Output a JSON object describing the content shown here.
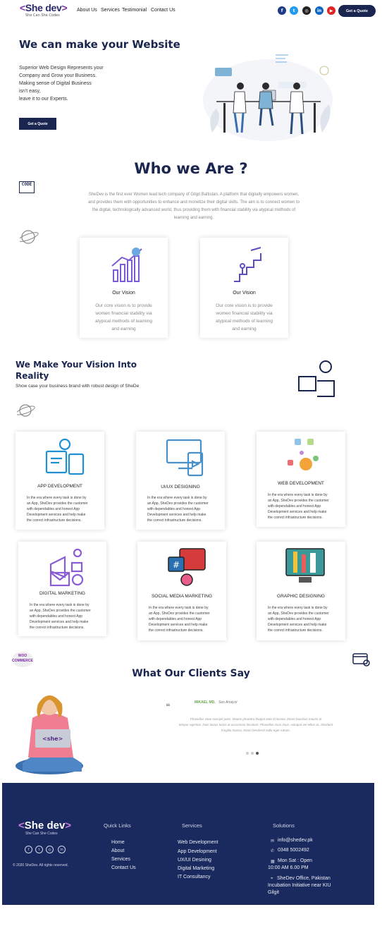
{
  "header": {
    "logo_text": "She dev",
    "logo_tagline": "She Can She Codes",
    "nav": [
      "About Us",
      "Services",
      "Testimonial",
      "Contact Us"
    ],
    "social": [
      {
        "icon": "facebook-icon",
        "glyph": "f",
        "color": "#1f3a8a"
      },
      {
        "icon": "twitter-icon",
        "glyph": "t",
        "color": "#1d9bf0"
      },
      {
        "icon": "instagram-icon",
        "glyph": "◎",
        "color": "#222222"
      },
      {
        "icon": "linkedin-icon",
        "glyph": "in",
        "color": "#0a66c2"
      },
      {
        "icon": "youtube-icon",
        "glyph": "▶",
        "color": "#e02424"
      }
    ],
    "quote_button": "Get a Quote"
  },
  "hero": {
    "title": "We can make your Website",
    "lines": [
      "Superior Web Design Represents your",
      "Company and Grow your Business.",
      "Making sense of Digital Business",
      "isn't easy,",
      "leave it to our Experts."
    ],
    "button": "Get a Quote"
  },
  "who": {
    "title": "Who we Are ?",
    "lines": [
      "SheDev is the first ever Women lead tech company of Gilgit Baltistan. A platform that digitally empowers women,",
      "and provides them with opportunities to enhance and monetize their digital skills. The aim is to connect women to",
      "the digital, technologically advanced world, thus providing them with financial stability via atypical methods of",
      "learning and earning."
    ],
    "code_badge": "CODE",
    "cards": [
      {
        "title": "Our Vision",
        "lines": [
          "Our core vision is to provide",
          "women financial stability via",
          "atypical methods of learning",
          "and earning"
        ]
      },
      {
        "title": "Our Vision",
        "lines": [
          "Our core vision is to provide",
          "women financial stability via",
          "atypical methods of learning",
          "and earning"
        ]
      }
    ]
  },
  "services": {
    "title_line1": "We Make Your Vision Into",
    "title_line2": "Reality",
    "subtitle": "Show case your business brand with robust design of SheDe",
    "desc_lines": [
      "In the era where every task is done by",
      "an App, SheDev provides the customer",
      "with dependables and honest App",
      "Development services and help make",
      "the correct infrastructure decisions."
    ],
    "items": [
      {
        "title": "APP DEVELOPMENT"
      },
      {
        "title": "UI/UX DESIGNING"
      },
      {
        "title": "WEB DEVELOPMENT"
      },
      {
        "title": "DIGITAL MARKETING"
      },
      {
        "title": "SOCIAL MEDIA MARKETING"
      },
      {
        "title": "GRAPHIC DESIGNING"
      }
    ]
  },
  "woo_badge": "WOO COMMERCE",
  "clients": {
    "title": "What Our Clients Say",
    "reviewer_name": "MIKAEL MD,",
    "reviewer_role": "Seo Analyst",
    "quote_lines": [
      "Phasellus vitae suscipit justo. Mauris pharetra feugiat ante id lacinia. Etiam faucibus mauris id",
      "tempor egestas. Duis luctus turpis at accumsan tincidunt. Phasellus risus risus, volutpat vel tellus ac, tincidunt",
      "fringilla massa. Etiam hendrerit nulla eget rutrum."
    ]
  },
  "footer": {
    "logo_text": "She dev",
    "logo_tagline": "She Can She Codes",
    "copyright": "© 2020 SheDev. All rights reserved.",
    "quick_links_title": "Quick Links",
    "quick_links": [
      "Home",
      "About",
      "Services",
      "Contact Us"
    ],
    "services_title": "Services",
    "services": [
      "Web Development",
      "App Development",
      "UX/UI Desining",
      "Digital Marketing",
      "IT Consultancy"
    ],
    "solutions_title": "Solutions",
    "email": "info@shedev.pk",
    "phone": "0348 5002492",
    "hours_line1": "Mon Sat : Open",
    "hours_line2": "10:00 AM    6.00 PM",
    "address_line1": "SheDev Office, Pakistan",
    "address_line2": "Incubation Initiative near KIU",
    "address_line3": "Gilgit"
  }
}
